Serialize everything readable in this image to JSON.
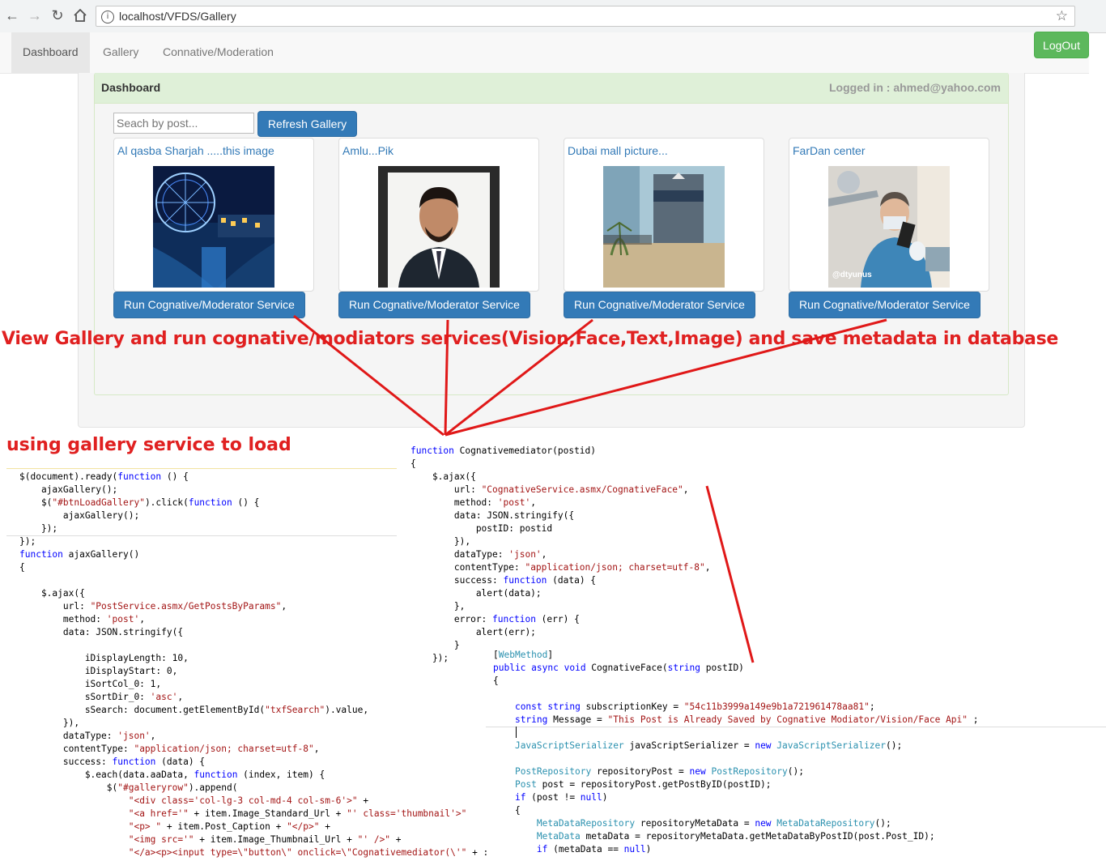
{
  "browser": {
    "url": "localhost/VFDS/Gallery"
  },
  "nav": {
    "items": [
      {
        "label": "Dashboard",
        "active": true
      },
      {
        "label": "Gallery",
        "active": false
      },
      {
        "label": "Connative/Moderation",
        "active": false
      }
    ],
    "logout": "LogOut"
  },
  "panel": {
    "title": "Dashboard",
    "logged_in": "Logged in : ahmed@yahoo.com"
  },
  "search": {
    "placeholder": "Seach by post...",
    "refresh_label": "Refresh Gallery"
  },
  "gallery": [
    {
      "caption": "Al qasba Sharjah .....this image",
      "button": "Run Cognative/Moderator Service"
    },
    {
      "caption": "Amlu...Pik",
      "button": "Run Cognative/Moderator Service"
    },
    {
      "caption": "Dubai mall picture...",
      "button": "Run Cognative/Moderator Service"
    },
    {
      "caption": "FarDan center",
      "button": "Run Cognative/Moderator Service",
      "watermark": "@dtyunus"
    }
  ],
  "annotations": {
    "main": "View Gallery  and run cognative/modiators services(Vision,Face,Text,Image) and save metadata in database",
    "left": "using gallery service to load"
  },
  "code": {
    "left": [
      "$(document).ready(function () {",
      "    ajaxGallery();",
      "    $(\"#btnLoadGallery\").click(function () {",
      "        ajaxGallery();",
      "    });",
      "});",
      "function ajaxGallery()",
      "{",
      "",
      "    $.ajax({",
      "        url: \"PostService.asmx/GetPostsByParams\",",
      "        method: 'post',",
      "        data: JSON.stringify({",
      "",
      "            iDisplayLength: 10,",
      "            iDisplayStart: 0,",
      "            iSortCol_0: 1,",
      "            sSortDir_0: 'asc',",
      "            sSearch: document.getElementById(\"txfSearch\").value,",
      "        }),",
      "        dataType: 'json',",
      "        contentType: \"application/json; charset=utf-8\",",
      "        success: function (data) {",
      "            $.each(data.aaData, function (index, item) {",
      "                $(\"#galleryrow\").append(",
      "                    \"<div class='col-lg-3 col-md-4 col-sm-6'>\" +",
      "                    \"<a href='\" + item.Image_Standard_Url + \"' class='thumbnail'>\"",
      "                    \"<p> \" + item.Post_Caption + \"</p>\" +",
      "                    \"<img src='\" + item.Image_Thumbnail_Url + \"' />\" +",
      "                    \"</a><p><input type=\\\"button\\\" onclick=\\\"Cognativemediator(\\'\" + :"
    ],
    "middle": [
      "function Cognativemediator(postid)",
      "{",
      "    $.ajax({",
      "        url: \"CognativeService.asmx/CognativeFace\",",
      "        method: 'post',",
      "        data: JSON.stringify({",
      "            postID: postid",
      "        }),",
      "        dataType: 'json',",
      "        contentType: \"application/json; charset=utf-8\",",
      "        success: function (data) {",
      "            alert(data);",
      "        },",
      "        error: function (err) {",
      "            alert(err);",
      "        }",
      "    });"
    ],
    "right1": [
      "[WebMethod]",
      "public async void CognativeFace(string postID)",
      "{",
      "",
      "    const string subscriptionKey = \"54c11b3999a149e9b1a721961478aa81\";",
      "    string Message = \"This Post is Already Saved by Cognative Modiator/Vision/Face Api\" ;"
    ],
    "right2": [
      "    JavaScriptSerializer javaScriptSerializer = new JavaScriptSerializer();",
      "",
      "    PostRepository repositoryPost = new PostRepository();",
      "    Post post = repositoryPost.getPostByID(postID);",
      "    if (post != null)",
      "    {",
      "        MetaDataRepository repositoryMetaData = new MetaDataRepository();",
      "        MetaData metaData = repositoryMetaData.getMetaDataByPostID(post.Post_ID);",
      "        if (metaData == null)"
    ]
  }
}
